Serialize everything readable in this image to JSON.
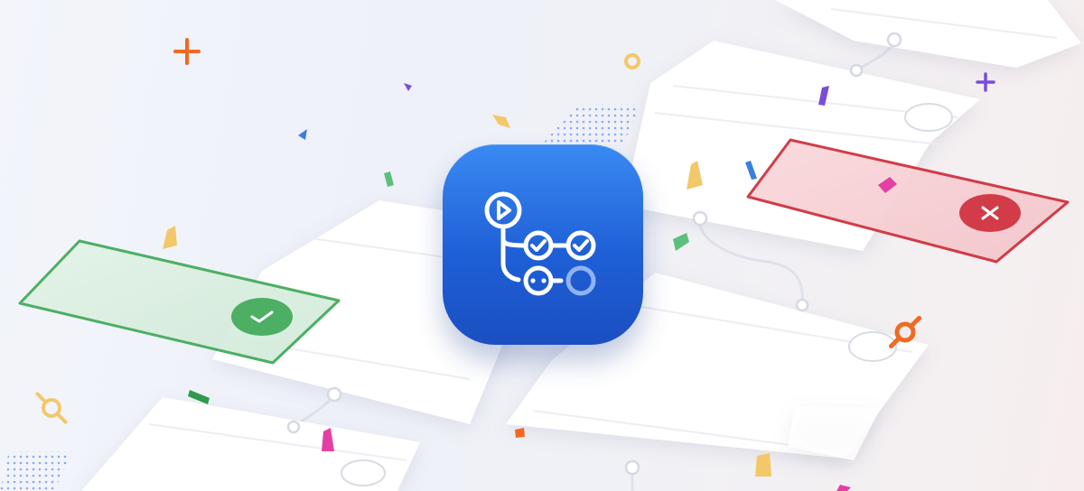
{
  "image": {
    "logo": {
      "name": "workflow-actions-logo",
      "colors": {
        "top": "#3a8af3",
        "bottom": "#1a4fc2",
        "glyph": "#ffffff",
        "pending": "#8fb3f2"
      }
    },
    "status_colors": {
      "success": "#4caf63",
      "failure": "#d13c48"
    },
    "confetti_colors": [
      "#f06a22",
      "#7a4dd8",
      "#3a7ee0",
      "#f3c86b",
      "#5cc07a",
      "#e43fa6"
    ]
  }
}
